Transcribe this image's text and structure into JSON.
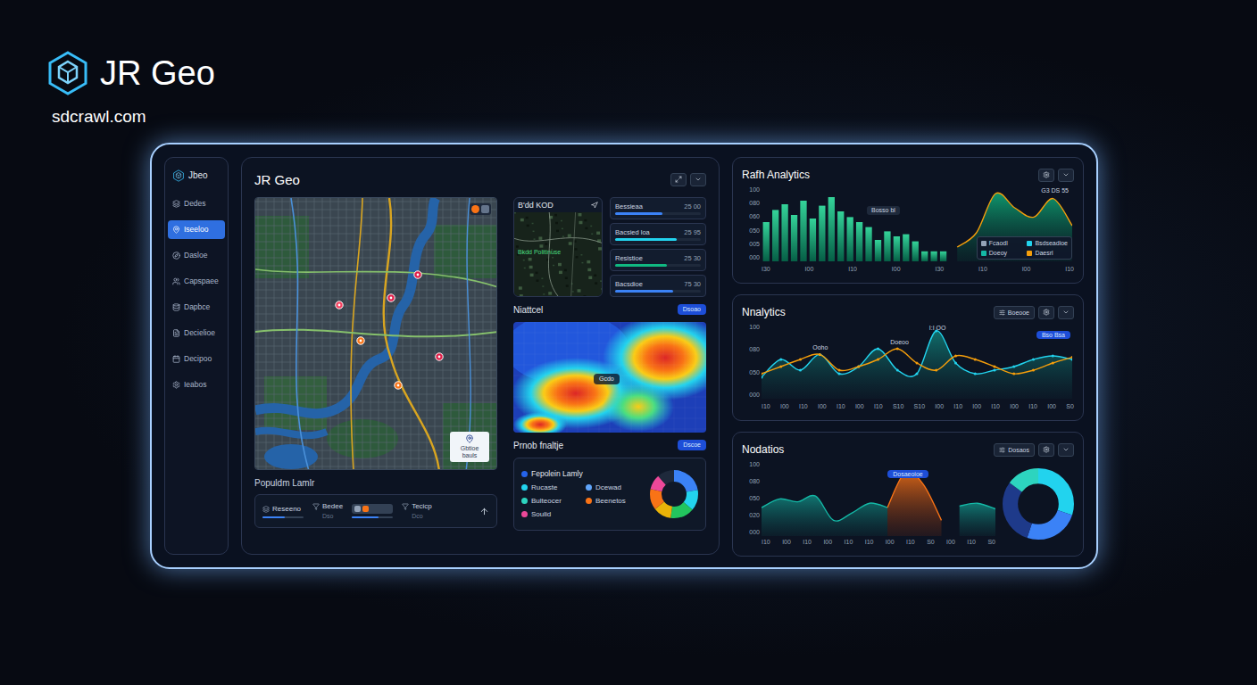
{
  "brand": {
    "name": "JR Geo",
    "site": "sdcrawl.com"
  },
  "sidebar": {
    "title": "Jbeo",
    "items": [
      {
        "label": "Dedes",
        "selected": false
      },
      {
        "label": "Iseeloo",
        "selected": true
      },
      {
        "label": "Dasloe",
        "selected": false
      },
      {
        "label": "Capspaee",
        "selected": false
      },
      {
        "label": "Dapbce",
        "selected": false
      },
      {
        "label": "Decielioe",
        "selected": false
      },
      {
        "label": "Decipoo",
        "selected": false
      },
      {
        "label": "Ieabos",
        "selected": false
      }
    ]
  },
  "main": {
    "title": "JR Geo",
    "map": {
      "card_label": "Gbtioe bauls"
    },
    "map_footer": {
      "title": "Populdm Lamlr",
      "controls": [
        {
          "kind": "meter",
          "label": "Reseeno",
          "level": 0.55
        },
        {
          "kind": "caption",
          "label": "Bedee",
          "sub": "Dso"
        },
        {
          "kind": "chips",
          "level": 0.65
        },
        {
          "kind": "caption",
          "label": "Tecicp",
          "sub": "Dco"
        }
      ]
    },
    "satellite": {
      "title": "B'dd KOD",
      "overlay": "Bkdd Politinuse"
    },
    "stats": [
      {
        "label": "Bessieaa",
        "reading": "25 00",
        "level": 0.55,
        "color": "#3b82f6"
      },
      {
        "label": "Bacsied loa",
        "reading": "25 95",
        "level": 0.72,
        "color": "#22d3ee"
      },
      {
        "label": "Resistioe",
        "reading": "25 30",
        "level": 0.6,
        "color": "#10b981"
      },
      {
        "label": "Bacsdioe",
        "reading": "75 30",
        "level": 0.68,
        "color": "#3b82f6"
      }
    ],
    "heatmap": {
      "title": "Niattcel",
      "badge": "Dsoao",
      "label": "Gcdo"
    },
    "breakdown": {
      "title": "Prnob fnaltje",
      "badge": "Dscoe",
      "legend_title": "Fepolein Lamly",
      "items": [
        {
          "label": "Rucaste",
          "color": "#22d3ee"
        },
        {
          "label": "Dcewad",
          "color": "#60a5fa"
        },
        {
          "label": "Bulteocer",
          "color": "#2dd4bf"
        },
        {
          "label": "Beenetos",
          "color": "#f97316"
        },
        {
          "label": "Soulid",
          "color": "#ec4899"
        }
      ],
      "donut": [
        {
          "value": 22,
          "color": "#3b82f6"
        },
        {
          "value": 14,
          "color": "#22d3ee"
        },
        {
          "value": 16,
          "color": "#22c55e"
        },
        {
          "value": 12,
          "color": "#eab308"
        },
        {
          "value": 14,
          "color": "#f97316"
        },
        {
          "value": 10,
          "color": "#ec4899"
        },
        {
          "value": 12,
          "color": "#1e293b"
        }
      ]
    }
  },
  "bar_chart": {
    "title": "Rafh Analytics",
    "y_ticks": [
      "100",
      "080",
      "060",
      "050",
      "005",
      "000"
    ],
    "x_ticks": [
      "I30",
      "I00",
      "I10",
      "I00",
      "I30",
      "I10",
      "I00",
      "I10"
    ],
    "bars": [
      55,
      72,
      80,
      65,
      85,
      60,
      78,
      90,
      70,
      62,
      55,
      48,
      30,
      42,
      35,
      38,
      28,
      14,
      14,
      14
    ],
    "area": [
      20,
      40,
      95,
      75,
      62,
      88,
      50
    ],
    "badge": "Bosso bl",
    "area_label": "G3 DS 55",
    "legend": [
      {
        "label": "Fcaodl",
        "color": "#94a3b8"
      },
      {
        "label": "Bsdseadioe",
        "color": "#22d3ee"
      },
      {
        "label": "Doeoy",
        "color": "#14b8a6"
      },
      {
        "label": "Daesrl",
        "color": "#f59e0b"
      }
    ]
  },
  "line_chart": {
    "title": "Nnalytics",
    "button": "Boeooe",
    "badge": "Bso Bsa",
    "y_ticks": [
      "100",
      "080",
      "050",
      "000"
    ],
    "x_ticks": [
      "I10",
      "I00",
      "I10",
      "I00",
      "I10",
      "I00",
      "I10",
      "S10",
      "S10",
      "I00",
      "I10",
      "I00",
      "I10",
      "I00",
      "I10",
      "I00",
      "S0"
    ],
    "series": [
      {
        "kind": "area",
        "color": "#22d3ee",
        "values": [
          30,
          55,
          40,
          62,
          35,
          45,
          70,
          40,
          35,
          95,
          50,
          35,
          40,
          45,
          55,
          60,
          55
        ]
      },
      {
        "kind": "line",
        "color": "#f59e0b",
        "values": [
          35,
          45,
          55,
          62,
          40,
          45,
          55,
          70,
          50,
          40,
          60,
          55,
          45,
          35,
          40,
          50,
          58
        ]
      }
    ],
    "annotations": [
      {
        "label": "Ooho",
        "index": 3
      },
      {
        "label": "Doeoo",
        "index": 7
      },
      {
        "label": "I:I OO",
        "index": 9
      }
    ]
  },
  "area_chart": {
    "title": "Nodatios",
    "button": "Dosaos",
    "y_ticks": [
      "100",
      "080",
      "050",
      "020",
      "000"
    ],
    "x_ticks": [
      "I10",
      "I00",
      "I10",
      "I00",
      "I10",
      "I10",
      "I00",
      "I10",
      "S0",
      "I00",
      "I10",
      "S0"
    ],
    "series": [
      {
        "color": "#14b8a6",
        "values": [
          40,
          52,
          48,
          56,
          22,
          32,
          46,
          40,
          null,
          null,
          null,
          42,
          46,
          38
        ]
      },
      {
        "color": "#f97316",
        "values": [
          null,
          null,
          null,
          null,
          null,
          null,
          null,
          40,
          90,
          72,
          22,
          null,
          null,
          null
        ]
      }
    ],
    "badge": "Dosaeoioe",
    "badge_index": 8,
    "donut": [
      {
        "value": 30,
        "color": "#22d3ee"
      },
      {
        "value": 25,
        "color": "#3b82f6"
      },
      {
        "value": 30,
        "color": "#1e3a8a"
      },
      {
        "value": 15,
        "color": "#2dd4bf"
      }
    ]
  }
}
